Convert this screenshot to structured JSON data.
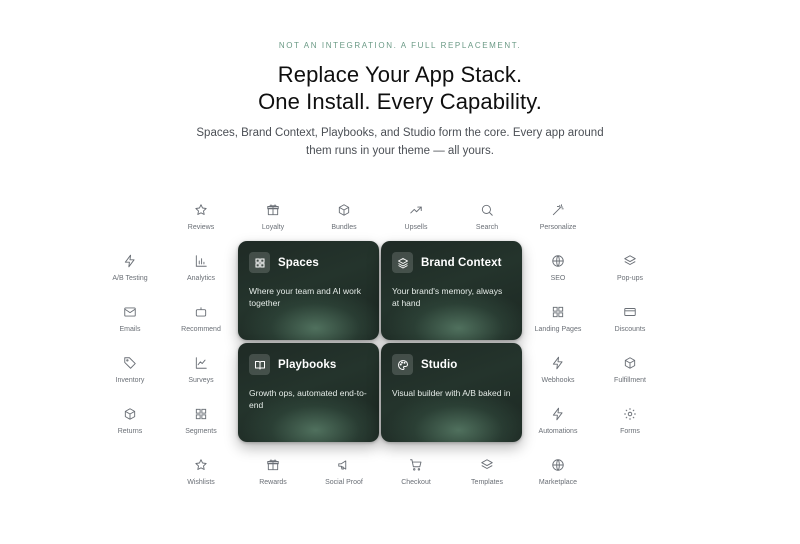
{
  "hero": {
    "eyebrow": "NOT AN INTEGRATION. A FULL REPLACEMENT.",
    "headline_line1": "Replace Your App Stack.",
    "headline_line2": "One Install. Every Capability.",
    "subtext": "Spaces, Brand Context, Playbooks, and Studio form the core. Every app around them runs in your theme — all yours."
  },
  "core_cards": [
    {
      "title": "Spaces",
      "description": "Where your team and AI work together",
      "icon": "grid-icon"
    },
    {
      "title": "Brand Context",
      "description": "Your brand's memory, always at hand",
      "icon": "layers-icon"
    },
    {
      "title": "Playbooks",
      "description": "Growth ops, automated end-to-end",
      "icon": "book-icon"
    },
    {
      "title": "Studio",
      "description": "Visual builder with A/B baked in",
      "icon": "palette-icon"
    }
  ],
  "apps": [
    {
      "label": "Reviews",
      "icon": "star-icon"
    },
    {
      "label": "Loyalty",
      "icon": "gift-icon"
    },
    {
      "label": "Bundles",
      "icon": "box-icon"
    },
    {
      "label": "Upsells",
      "icon": "trending-up-icon"
    },
    {
      "label": "Search",
      "icon": "search-icon"
    },
    {
      "label": "Personalize",
      "icon": "magic-wand-icon"
    },
    {
      "label": "A/B Testing",
      "icon": "lightning-icon"
    },
    {
      "label": "Analytics",
      "icon": "bar-chart-icon"
    },
    {
      "label": "SEO",
      "icon": "globe-icon"
    },
    {
      "label": "Pop-ups",
      "icon": "layers-icon"
    },
    {
      "label": "Emails",
      "icon": "mail-icon"
    },
    {
      "label": "Recommend",
      "icon": "robot-icon"
    },
    {
      "label": "Landing Pages",
      "icon": "grid-icon"
    },
    {
      "label": "Discounts",
      "icon": "credit-card-icon"
    },
    {
      "label": "Inventory",
      "icon": "tag-icon"
    },
    {
      "label": "Surveys",
      "icon": "line-chart-icon"
    },
    {
      "label": "Webhooks",
      "icon": "lightning-icon"
    },
    {
      "label": "Fulfillment",
      "icon": "box-icon"
    },
    {
      "label": "Returns",
      "icon": "box-icon"
    },
    {
      "label": "Segments",
      "icon": "grid-icon"
    },
    {
      "label": "Automations",
      "icon": "lightning-icon"
    },
    {
      "label": "Forms",
      "icon": "gear-icon"
    },
    {
      "label": "Wishlists",
      "icon": "star-icon"
    },
    {
      "label": "Rewards",
      "icon": "gift-icon"
    },
    {
      "label": "Social Proof",
      "icon": "megaphone-icon"
    },
    {
      "label": "Checkout",
      "icon": "cart-icon"
    },
    {
      "label": "Templates",
      "icon": "layers-icon"
    },
    {
      "label": "Marketplace",
      "icon": "globe-icon"
    }
  ],
  "colors": {
    "eyebrow": "#6b9a86",
    "card_bg": "#1f2a25",
    "card_glow": "#608770",
    "app_icon": "#6a6f76"
  }
}
